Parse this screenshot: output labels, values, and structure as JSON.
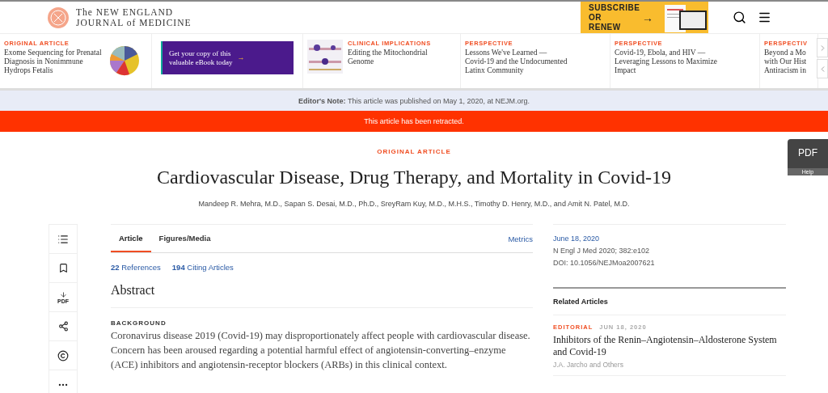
{
  "header": {
    "logo_lines": [
      "The NEW ENGLAND",
      "JOURNAL of MEDICINE"
    ],
    "subscribe": "SUBSCRIBE OR RENEW",
    "subscribe_arrow": "→"
  },
  "carousel": [
    {
      "kind": "article",
      "label": "ORIGINAL ARTICLE",
      "title_lines": [
        "Exome Sequencing for Prenatal",
        "Diagnosis in Nonimmune",
        "Hydrops Fetalis"
      ]
    },
    {
      "kind": "ad",
      "text_lines": [
        "Get your copy of this",
        "valuable eBook today"
      ],
      "arrow": "→"
    },
    {
      "kind": "article",
      "label": "CLINICAL IMPLICATIONS",
      "title_lines": [
        "Editing the Mitochondrial",
        "Genome"
      ]
    },
    {
      "kind": "article",
      "label": "PERSPECTIVE",
      "title_lines": [
        "Lessons We've Learned —",
        "Covid-19 and the Undocumented",
        "Latinx Community"
      ]
    },
    {
      "kind": "article",
      "label": "PERSPECTIVE",
      "title_lines": [
        "Covid-19, Ebola, and HIV —",
        "Leveraging Lessons to Maximize",
        "Impact"
      ]
    },
    {
      "kind": "article",
      "label": "PERSPECTIV",
      "title_lines": [
        "Beyond a Mo",
        "with Our Hist",
        "Antiracism in"
      ]
    }
  ],
  "editors_note": "**Editor's Note:** This article was published on May 1, 2020, at NEJM.org.",
  "retraction": "This article has been retracted.",
  "article": {
    "type": "ORIGINAL ARTICLE",
    "title": "Cardiovascular Disease, Drug Therapy, and Mortality in Covid-19",
    "authors": "Mandeep R. Mehra, M.D., Sapan S. Desai, M.D., Ph.D., SreyRam Kuy, M.D., M.H.S., Timothy D. Henry, M.D., and Amit N. Patel, M.D."
  },
  "pdf_button": {
    "label": "PDF",
    "help": "Help"
  },
  "tools": [
    {
      "kind": "list"
    },
    {
      "kind": "bookmark"
    },
    {
      "kind": "pdf",
      "label": "PDF"
    },
    {
      "kind": "share"
    },
    {
      "kind": "copyright"
    },
    {
      "kind": "more"
    }
  ],
  "tabs": [
    {
      "label": "Article",
      "selected": true
    },
    {
      "label": "Figures/Media",
      "selected": false
    }
  ],
  "metrics": "Metrics",
  "links": [
    "**22** References",
    "**194** Citing Articles"
  ],
  "abstract": {
    "heading": "Abstract",
    "section": "BACKGROUND",
    "text": "Coronavirus disease 2019 (Covid-19) may disproportionately affect people with cardiovascular disease. Concern has been aroused regarding a potential harmful effect of angiotensin-converting–enzyme (ACE) inhibitors and angiotensin-receptor blockers (ARBs) in this clinical context."
  },
  "citation": {
    "date": "June 18, 2020",
    "journal": "N Engl J Med 2020; 382:e102",
    "doi": "DOI: 10.1056/NEJMoa2007621"
  },
  "related": {
    "heading": "Related Articles",
    "items": [
      {
        "type": "EDITORIAL",
        "date": "JUN 18, 2020",
        "title": "Inhibitors of the Renin–Angiotensin–Aldosterone System and Covid-19",
        "authors": "J.A. Jarcho and Others"
      }
    ]
  }
}
